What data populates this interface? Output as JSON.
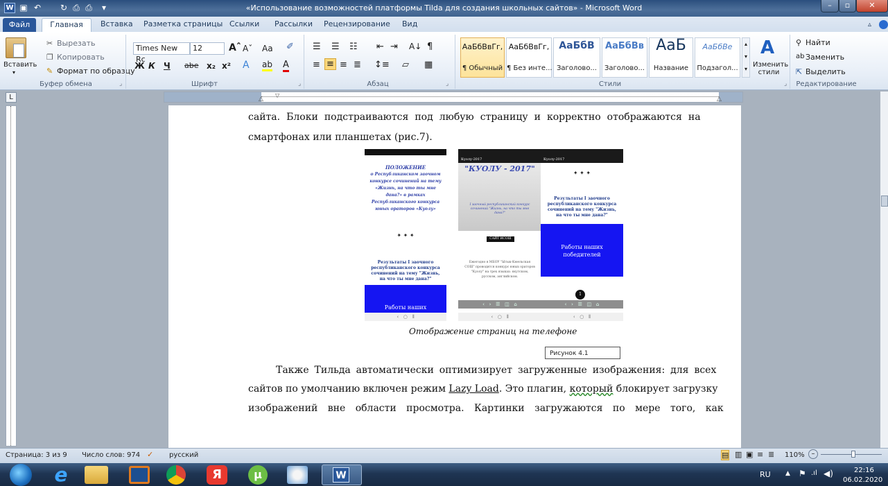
{
  "window": {
    "title": "«Использование возможностей платформы Tilda для создания школьных сайтов» - Microsoft Word"
  },
  "tabs": [
    "Главная",
    "Вставка",
    "Разметка страницы",
    "Ссылки",
    "Рассылки",
    "Рецензирование",
    "Вид"
  ],
  "file_tab": "Файл",
  "clipboard": {
    "paste": "Вставить",
    "cut": "Вырезать",
    "copy": "Копировать",
    "format_painter": "Формат по образцу",
    "label": "Буфер обмена"
  },
  "font": {
    "name": "Times New Rc",
    "size": "12",
    "label": "Шрифт",
    "bold": "Ж",
    "italic": "К",
    "underline": "Ч",
    "strike": "abe",
    "sub": "x₂",
    "sup": "x²",
    "case": "Aa"
  },
  "paragraph": {
    "label": "Абзац"
  },
  "styles": {
    "items": [
      {
        "preview": "АаБбВвГг,",
        "name": "¶ Обычный"
      },
      {
        "preview": "АаБбВвГг,",
        "name": "¶ Без инте..."
      },
      {
        "preview": "АаБбВ",
        "name": "Заголово..."
      },
      {
        "preview": "АаБбВв",
        "name": "Заголово..."
      },
      {
        "preview": "АаБ",
        "name": "Название"
      },
      {
        "preview": "АаБбВе",
        "name": "Подзагол..."
      }
    ],
    "change": "Изменить стили",
    "label": "Стили"
  },
  "editing": {
    "find": "Найти",
    "replace": "Заменить",
    "select": "Выделить",
    "label": "Редактирование"
  },
  "document": {
    "line1": "сайта. Блоки подстраиваются под любую страницу и корректно отображаются на",
    "line2": "смартфонах или планшетах (рис.7).",
    "caption": "Отображение страниц на телефоне",
    "figure_label": "Рисунок 4.1",
    "p2_line1": "Также Тильда автоматически оптимизирует загруженные изображения: для всех",
    "p2_line2a": "сайтов по умолчанию включен режим ",
    "p2_link": "Lazy Load",
    "p2_line2b": ". Это плагин, ",
    "p2_word": "который",
    "p2_line2c": " блокирует загрузку",
    "p2_line3": "изображений вне области просмотра. Картинки загружаются по мере того, как"
  },
  "phone1": {
    "title": "ПОЛОЖЕНИЕ",
    "body": "о Республиканском заочном конкурсе сочинений на тему «Жизнь, на что ты мне дана?» в рамках Республиканского конкурса юных ораторов «Куолу»",
    "stars": "✦ ✦ ✦",
    "result": "Результаты I заочного республиканского конкурса сочинений на тему \"Жизнь, на что ты мне дана?\"",
    "button": "Работы наших"
  },
  "phone2": {
    "site": "Куолу-2017",
    "heading": "\"КУОЛУ - 2017\"",
    "sub": "I заочный республиканский конкурс сочинений \"Жизнь, на что ты мне дана?\"",
    "button": "САЙТ ИСОШ",
    "text": "Ежегодно в МБОУ \"Ытык-Кюельская СОШ\" проводится конкурс юных ораторов \"Куолу\" на трех языках: якутском, русском, английском."
  },
  "phone3": {
    "site": "Куолу-2017",
    "stars": "✦ ✦ ✦",
    "result": "Результаты I заочного республиканского конкурса сочинений на тему \"Жизнь, на что ты мне дана?\"",
    "button": "Работы наших победителей",
    "badge": "1"
  },
  "status": {
    "page": "Страница: 3 из 9",
    "words": "Число слов: 974",
    "lang": "русский",
    "zoom": "110%"
  },
  "taskbar": {
    "lang": "RU",
    "time": "22:16",
    "date": "06.02.2020"
  },
  "ruler": {
    "corner": "L"
  },
  "colors": {
    "title_bar": "#2b4f7e",
    "file_tab": "#2a579a",
    "phone_blue": "#1515f2"
  }
}
